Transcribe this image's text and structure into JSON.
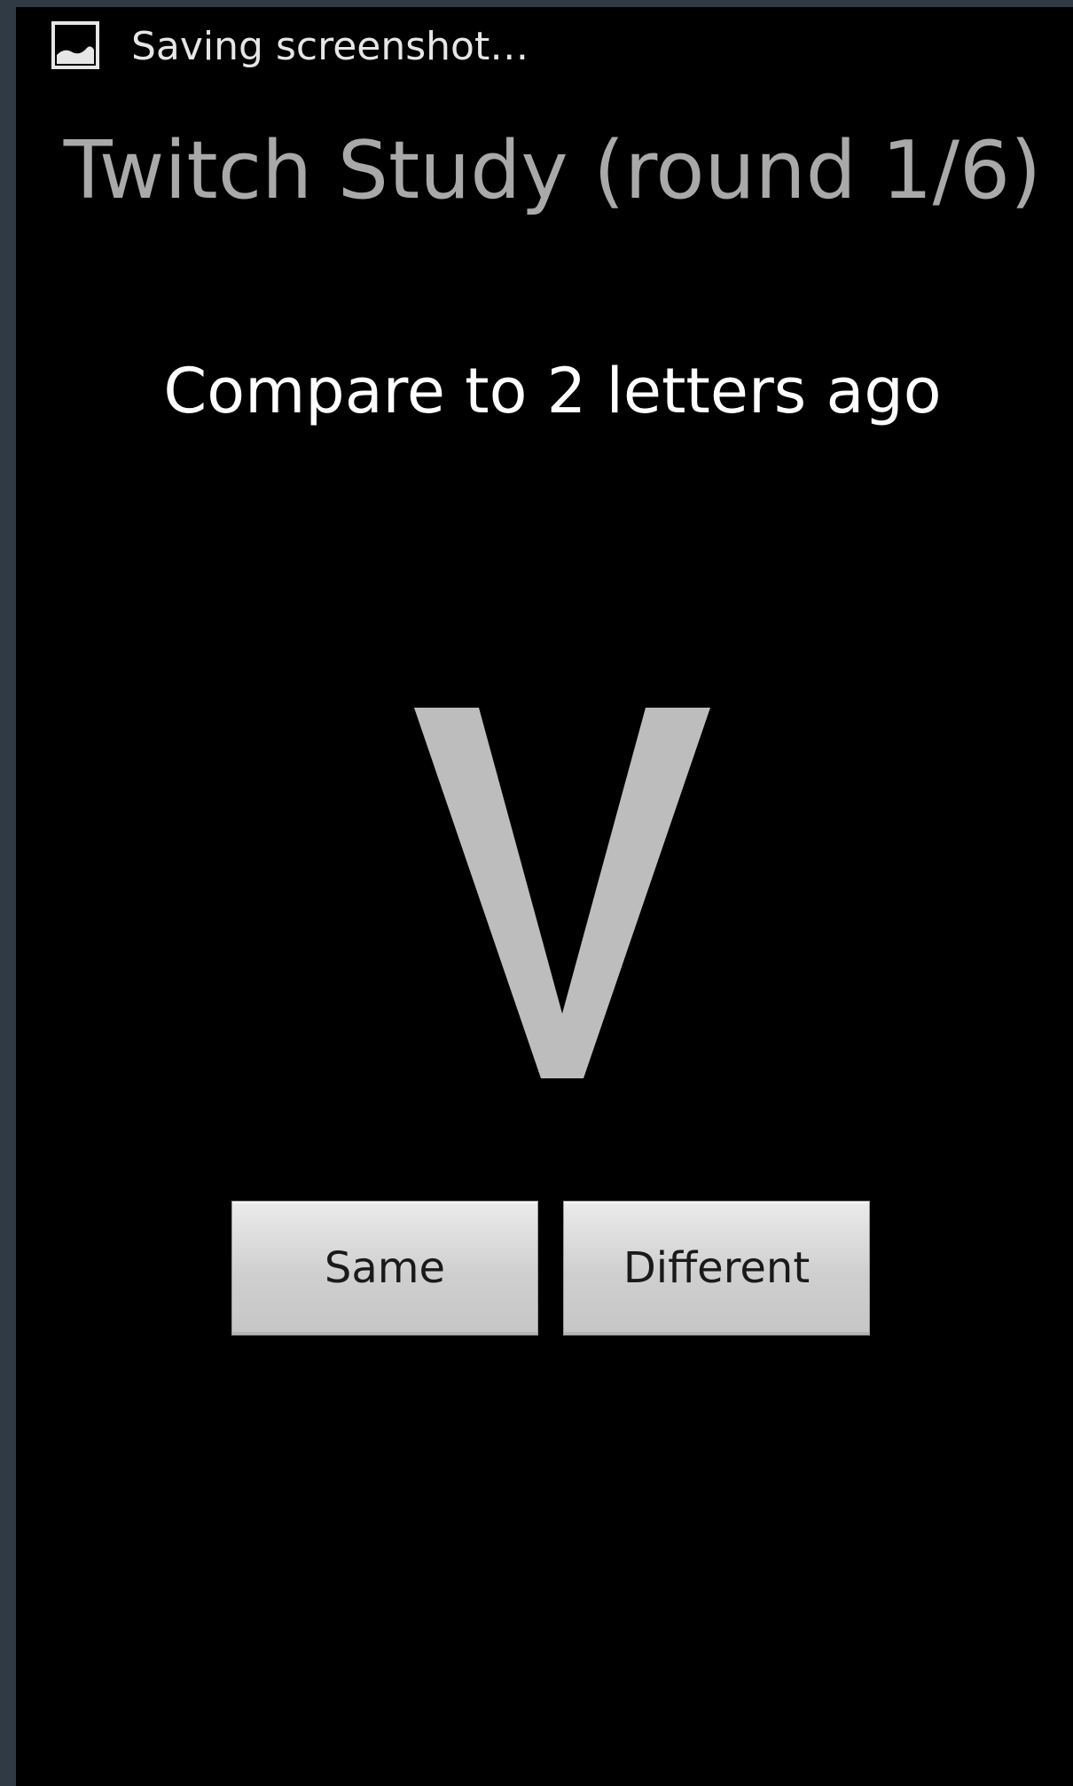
{
  "status_bar": {
    "icon": "image-icon",
    "text": "Saving screenshot…"
  },
  "header": {
    "title": "Twitch Study (round 1/6)"
  },
  "task": {
    "instruction": "Compare to 2 letters ago",
    "current_letter": "V"
  },
  "buttons": {
    "same_label": "Same",
    "different_label": "Different"
  },
  "colors": {
    "background": "#000000",
    "title": "#a9a9a9",
    "letter": "#bdbdbd",
    "instruction": "#ffffff"
  }
}
